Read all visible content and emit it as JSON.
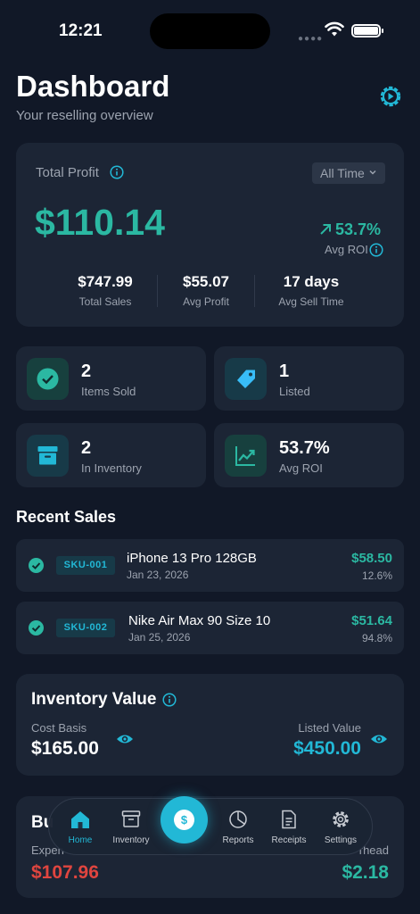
{
  "status": {
    "time": "12:21"
  },
  "header": {
    "title": "Dashboard",
    "subtitle": "Your reselling overview"
  },
  "profit": {
    "label": "Total Profit",
    "range": "All Time",
    "amount": "$110.14",
    "roi_value": "53.7%",
    "roi_label": "Avg ROI",
    "stats": [
      {
        "value": "$747.99",
        "label": "Total Sales"
      },
      {
        "value": "$55.07",
        "label": "Avg Profit"
      },
      {
        "value": "17 days",
        "label": "Avg Sell Time"
      }
    ]
  },
  "tiles": [
    {
      "value": "2",
      "label": "Items Sold",
      "icon": "check-circle-icon"
    },
    {
      "value": "1",
      "label": "Listed",
      "icon": "tag-icon"
    },
    {
      "value": "2",
      "label": "In Inventory",
      "icon": "archive-box-icon"
    },
    {
      "value": "53.7%",
      "label": "Avg ROI",
      "icon": "trend-up-icon"
    }
  ],
  "recent": {
    "title": "Recent Sales",
    "items": [
      {
        "sku": "SKU-001",
        "name": "iPhone 13 Pro 128GB",
        "date": "Jan 23, 2026",
        "price": "$58.50",
        "pct": "12.6%"
      },
      {
        "sku": "SKU-002",
        "name": "Nike Air Max 90 Size 10",
        "date": "Jan 25, 2026",
        "price": "$51.64",
        "pct": "94.8%"
      }
    ]
  },
  "inventory": {
    "title": "Inventory Value",
    "cost_label": "Cost Basis",
    "cost_value": "$165.00",
    "listed_label": "Listed Value",
    "listed_value": "$450.00"
  },
  "budget": {
    "title": "Bu",
    "expenses_label": "Expen",
    "expenses_value": "$107.96",
    "overhead_label": "rhead",
    "overhead_value": "$2.18"
  },
  "tabs": [
    {
      "label": "Home",
      "icon": "home-icon"
    },
    {
      "label": "Inventory",
      "icon": "archive-icon"
    },
    {
      "label": "$",
      "icon": "dollar-icon"
    },
    {
      "label": "Reports",
      "icon": "pie-chart-icon"
    },
    {
      "label": "Receipts",
      "icon": "document-icon"
    },
    {
      "label": "Settings",
      "icon": "gear-icon"
    }
  ],
  "colors": {
    "accent": "#22b8d6",
    "profit": "#2bb8a2",
    "negative": "#e0453f",
    "card": "#1c2535",
    "background": "#111827"
  }
}
